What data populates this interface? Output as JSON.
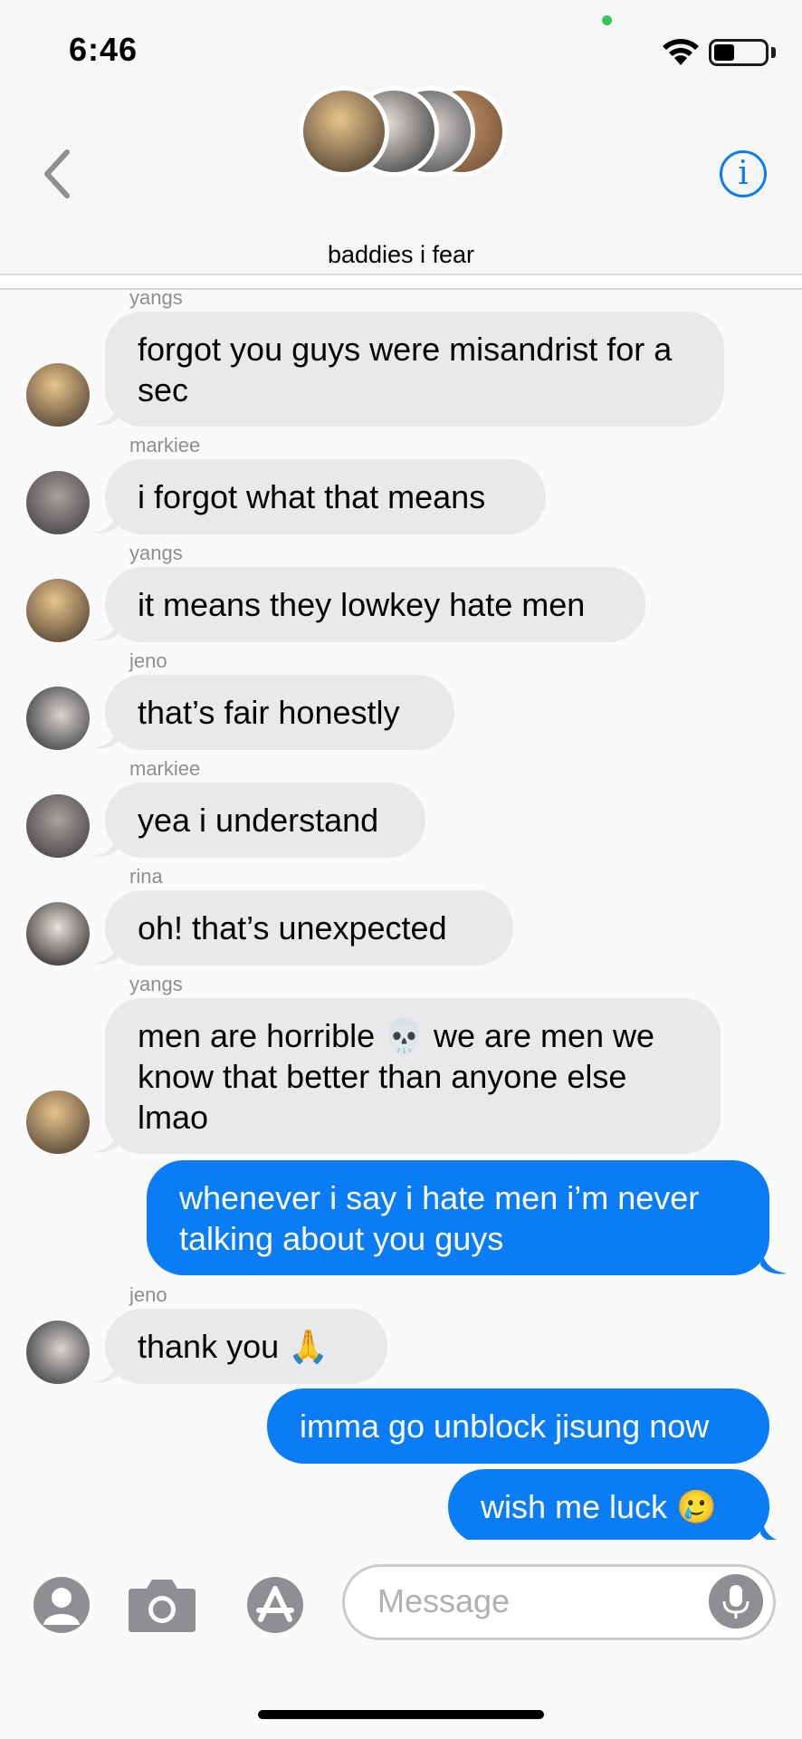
{
  "status_bar": {
    "time": "6:46"
  },
  "header": {
    "group_name": "baddies i fear",
    "back_icon": "chevron-left-icon",
    "info_glyph": "i"
  },
  "messages": [
    {
      "sender": "yangs",
      "text": "forgot you guys were misandrist for a sec",
      "direction": "in"
    },
    {
      "sender": "markiee",
      "text": "i forgot what that means",
      "direction": "in"
    },
    {
      "sender": "yangs",
      "text": "it means they lowkey hate men",
      "direction": "in"
    },
    {
      "sender": "jeno",
      "text": "that’s fair honestly",
      "direction": "in"
    },
    {
      "sender": "markiee",
      "text": "yea i understand",
      "direction": "in"
    },
    {
      "sender": "rina",
      "text": "oh! that’s unexpected",
      "direction": "in"
    },
    {
      "sender": "yangs",
      "text": "men are horrible 💀 we are men we know that better than anyone else lmao",
      "direction": "in"
    },
    {
      "sender": "",
      "text": "whenever i say i hate men i’m never talking about you guys",
      "direction": "out"
    },
    {
      "sender": "jeno",
      "text": "thank you 🙏",
      "direction": "in"
    },
    {
      "sender": "",
      "text": "imma go unblock jisung now",
      "direction": "out"
    },
    {
      "sender": "",
      "text": "wish me luck 🥲",
      "direction": "out"
    }
  ],
  "compose": {
    "placeholder": "Message",
    "icons": [
      "contact-icon",
      "camera-icon",
      "app-store-icon",
      "microphone-icon"
    ]
  },
  "colors": {
    "outgoing_bubble": "#0a7cf5",
    "incoming_bubble": "#e9e9eb",
    "accent": "#0a7cf5"
  }
}
